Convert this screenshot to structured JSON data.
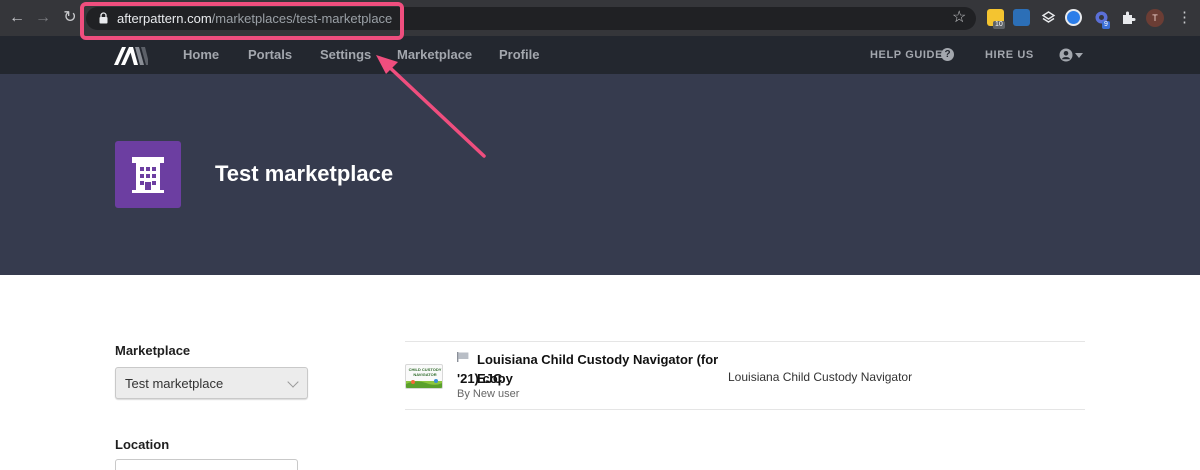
{
  "browser": {
    "url_host": "afterpattern.com",
    "url_path": "/marketplaces/test-marketplace",
    "extension_badges": [
      "10",
      "9"
    ],
    "profile_initial": "T"
  },
  "nav": {
    "links": [
      "Home",
      "Portals",
      "Settings",
      "Marketplace",
      "Profile"
    ],
    "help_guide": "HELP GUIDE",
    "hire_us": "HIRE US"
  },
  "hero": {
    "title": "Test marketplace"
  },
  "sidebar": {
    "marketplace_label": "Marketplace",
    "marketplace_value": "Test marketplace",
    "location_label": "Location"
  },
  "listing": {
    "title_line1": "Louisiana Child Custody Navigator (for EJC",
    "title_line2": "'21) copy",
    "author": "By New user",
    "source": "Louisiana Child Custody Navigator",
    "thumbnail_text": "CHILD CUSTODY NAVIGATOR"
  },
  "colors": {
    "chrome": "#35363a",
    "appnav": "#23272f",
    "hero": "#363b4e",
    "hero_icon": "#6c3ea1",
    "annotation": "#ef4e7e"
  }
}
